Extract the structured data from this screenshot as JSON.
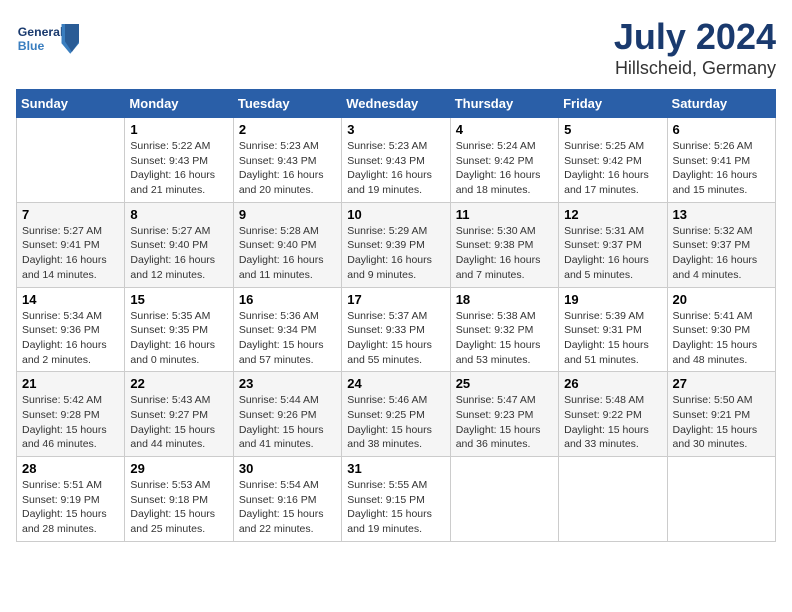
{
  "header": {
    "logo_general": "General",
    "logo_blue": "Blue",
    "title": "July 2024",
    "subtitle": "Hillscheid, Germany"
  },
  "columns": [
    "Sunday",
    "Monday",
    "Tuesday",
    "Wednesday",
    "Thursday",
    "Friday",
    "Saturday"
  ],
  "weeks": [
    [
      {
        "day": "",
        "sunrise": "",
        "sunset": "",
        "daylight": ""
      },
      {
        "day": "1",
        "sunrise": "Sunrise: 5:22 AM",
        "sunset": "Sunset: 9:43 PM",
        "daylight": "Daylight: 16 hours and 21 minutes."
      },
      {
        "day": "2",
        "sunrise": "Sunrise: 5:23 AM",
        "sunset": "Sunset: 9:43 PM",
        "daylight": "Daylight: 16 hours and 20 minutes."
      },
      {
        "day": "3",
        "sunrise": "Sunrise: 5:23 AM",
        "sunset": "Sunset: 9:43 PM",
        "daylight": "Daylight: 16 hours and 19 minutes."
      },
      {
        "day": "4",
        "sunrise": "Sunrise: 5:24 AM",
        "sunset": "Sunset: 9:42 PM",
        "daylight": "Daylight: 16 hours and 18 minutes."
      },
      {
        "day": "5",
        "sunrise": "Sunrise: 5:25 AM",
        "sunset": "Sunset: 9:42 PM",
        "daylight": "Daylight: 16 hours and 17 minutes."
      },
      {
        "day": "6",
        "sunrise": "Sunrise: 5:26 AM",
        "sunset": "Sunset: 9:41 PM",
        "daylight": "Daylight: 16 hours and 15 minutes."
      }
    ],
    [
      {
        "day": "7",
        "sunrise": "Sunrise: 5:27 AM",
        "sunset": "Sunset: 9:41 PM",
        "daylight": "Daylight: 16 hours and 14 minutes."
      },
      {
        "day": "8",
        "sunrise": "Sunrise: 5:27 AM",
        "sunset": "Sunset: 9:40 PM",
        "daylight": "Daylight: 16 hours and 12 minutes."
      },
      {
        "day": "9",
        "sunrise": "Sunrise: 5:28 AM",
        "sunset": "Sunset: 9:40 PM",
        "daylight": "Daylight: 16 hours and 11 minutes."
      },
      {
        "day": "10",
        "sunrise": "Sunrise: 5:29 AM",
        "sunset": "Sunset: 9:39 PM",
        "daylight": "Daylight: 16 hours and 9 minutes."
      },
      {
        "day": "11",
        "sunrise": "Sunrise: 5:30 AM",
        "sunset": "Sunset: 9:38 PM",
        "daylight": "Daylight: 16 hours and 7 minutes."
      },
      {
        "day": "12",
        "sunrise": "Sunrise: 5:31 AM",
        "sunset": "Sunset: 9:37 PM",
        "daylight": "Daylight: 16 hours and 5 minutes."
      },
      {
        "day": "13",
        "sunrise": "Sunrise: 5:32 AM",
        "sunset": "Sunset: 9:37 PM",
        "daylight": "Daylight: 16 hours and 4 minutes."
      }
    ],
    [
      {
        "day": "14",
        "sunrise": "Sunrise: 5:34 AM",
        "sunset": "Sunset: 9:36 PM",
        "daylight": "Daylight: 16 hours and 2 minutes."
      },
      {
        "day": "15",
        "sunrise": "Sunrise: 5:35 AM",
        "sunset": "Sunset: 9:35 PM",
        "daylight": "Daylight: 16 hours and 0 minutes."
      },
      {
        "day": "16",
        "sunrise": "Sunrise: 5:36 AM",
        "sunset": "Sunset: 9:34 PM",
        "daylight": "Daylight: 15 hours and 57 minutes."
      },
      {
        "day": "17",
        "sunrise": "Sunrise: 5:37 AM",
        "sunset": "Sunset: 9:33 PM",
        "daylight": "Daylight: 15 hours and 55 minutes."
      },
      {
        "day": "18",
        "sunrise": "Sunrise: 5:38 AM",
        "sunset": "Sunset: 9:32 PM",
        "daylight": "Daylight: 15 hours and 53 minutes."
      },
      {
        "day": "19",
        "sunrise": "Sunrise: 5:39 AM",
        "sunset": "Sunset: 9:31 PM",
        "daylight": "Daylight: 15 hours and 51 minutes."
      },
      {
        "day": "20",
        "sunrise": "Sunrise: 5:41 AM",
        "sunset": "Sunset: 9:30 PM",
        "daylight": "Daylight: 15 hours and 48 minutes."
      }
    ],
    [
      {
        "day": "21",
        "sunrise": "Sunrise: 5:42 AM",
        "sunset": "Sunset: 9:28 PM",
        "daylight": "Daylight: 15 hours and 46 minutes."
      },
      {
        "day": "22",
        "sunrise": "Sunrise: 5:43 AM",
        "sunset": "Sunset: 9:27 PM",
        "daylight": "Daylight: 15 hours and 44 minutes."
      },
      {
        "day": "23",
        "sunrise": "Sunrise: 5:44 AM",
        "sunset": "Sunset: 9:26 PM",
        "daylight": "Daylight: 15 hours and 41 minutes."
      },
      {
        "day": "24",
        "sunrise": "Sunrise: 5:46 AM",
        "sunset": "Sunset: 9:25 PM",
        "daylight": "Daylight: 15 hours and 38 minutes."
      },
      {
        "day": "25",
        "sunrise": "Sunrise: 5:47 AM",
        "sunset": "Sunset: 9:23 PM",
        "daylight": "Daylight: 15 hours and 36 minutes."
      },
      {
        "day": "26",
        "sunrise": "Sunrise: 5:48 AM",
        "sunset": "Sunset: 9:22 PM",
        "daylight": "Daylight: 15 hours and 33 minutes."
      },
      {
        "day": "27",
        "sunrise": "Sunrise: 5:50 AM",
        "sunset": "Sunset: 9:21 PM",
        "daylight": "Daylight: 15 hours and 30 minutes."
      }
    ],
    [
      {
        "day": "28",
        "sunrise": "Sunrise: 5:51 AM",
        "sunset": "Sunset: 9:19 PM",
        "daylight": "Daylight: 15 hours and 28 minutes."
      },
      {
        "day": "29",
        "sunrise": "Sunrise: 5:53 AM",
        "sunset": "Sunset: 9:18 PM",
        "daylight": "Daylight: 15 hours and 25 minutes."
      },
      {
        "day": "30",
        "sunrise": "Sunrise: 5:54 AM",
        "sunset": "Sunset: 9:16 PM",
        "daylight": "Daylight: 15 hours and 22 minutes."
      },
      {
        "day": "31",
        "sunrise": "Sunrise: 5:55 AM",
        "sunset": "Sunset: 9:15 PM",
        "daylight": "Daylight: 15 hours and 19 minutes."
      },
      {
        "day": "",
        "sunrise": "",
        "sunset": "",
        "daylight": ""
      },
      {
        "day": "",
        "sunrise": "",
        "sunset": "",
        "daylight": ""
      },
      {
        "day": "",
        "sunrise": "",
        "sunset": "",
        "daylight": ""
      }
    ]
  ]
}
